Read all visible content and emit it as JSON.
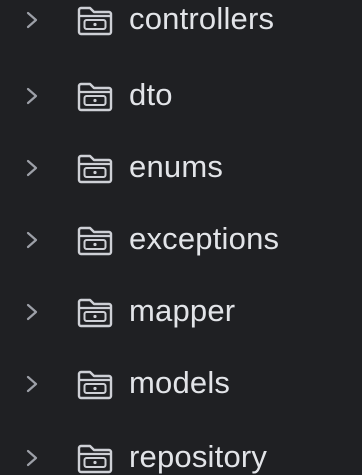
{
  "folders": [
    {
      "name": "controllers"
    },
    {
      "name": "dto"
    },
    {
      "name": "enums"
    },
    {
      "name": "exceptions"
    },
    {
      "name": "mapper"
    },
    {
      "name": "models"
    },
    {
      "name": "repository"
    }
  ],
  "icons": {
    "expand": "chevron-right-icon",
    "folder": "folder-icon"
  },
  "colors": {
    "background": "#1f2023",
    "text": "#e2e4e8",
    "icon": "#ced0d6",
    "chevron": "#9da0a8"
  }
}
